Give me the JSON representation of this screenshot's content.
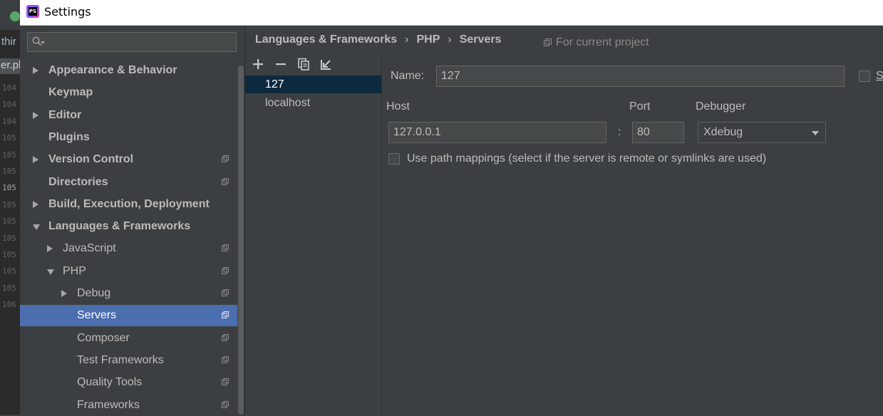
{
  "background_ide": {
    "text_1": "thir",
    "text_2": "er.pl",
    "line_numbers": [
      "104",
      "104",
      "104",
      "105",
      "105",
      "105",
      "105",
      "105",
      "105",
      "105",
      "105",
      "105",
      "105",
      "106"
    ]
  },
  "window": {
    "title": "Settings",
    "app_icon_text": "PS"
  },
  "sidebar": {
    "search": {
      "value": "",
      "placeholder": ""
    },
    "items": [
      {
        "label": "Appearance & Behavior",
        "bold": true,
        "expand": "collapsed",
        "level": 0,
        "project_scoped": false,
        "selected": false
      },
      {
        "label": "Keymap",
        "bold": true,
        "expand": "none",
        "level": 0,
        "project_scoped": false,
        "selected": false
      },
      {
        "label": "Editor",
        "bold": true,
        "expand": "collapsed",
        "level": 0,
        "project_scoped": false,
        "selected": false
      },
      {
        "label": "Plugins",
        "bold": true,
        "expand": "none",
        "level": 0,
        "project_scoped": false,
        "selected": false
      },
      {
        "label": "Version Control",
        "bold": true,
        "expand": "collapsed",
        "level": 0,
        "project_scoped": true,
        "selected": false
      },
      {
        "label": "Directories",
        "bold": true,
        "expand": "none",
        "level": 0,
        "project_scoped": true,
        "selected": false
      },
      {
        "label": "Build, Execution, Deployment",
        "bold": true,
        "expand": "collapsed",
        "level": 0,
        "project_scoped": false,
        "selected": false
      },
      {
        "label": "Languages & Frameworks",
        "bold": true,
        "expand": "expanded",
        "level": 0,
        "project_scoped": false,
        "selected": false
      },
      {
        "label": "JavaScript",
        "bold": false,
        "expand": "collapsed",
        "level": 1,
        "project_scoped": true,
        "selected": false
      },
      {
        "label": "PHP",
        "bold": false,
        "expand": "expanded",
        "level": 1,
        "project_scoped": true,
        "selected": false
      },
      {
        "label": "Debug",
        "bold": false,
        "expand": "collapsed",
        "level": 2,
        "project_scoped": true,
        "selected": false
      },
      {
        "label": "Servers",
        "bold": false,
        "expand": "none",
        "level": 2,
        "project_scoped": true,
        "selected": true
      },
      {
        "label": "Composer",
        "bold": false,
        "expand": "none",
        "level": 2,
        "project_scoped": true,
        "selected": false
      },
      {
        "label": "Test Frameworks",
        "bold": false,
        "expand": "none",
        "level": 2,
        "project_scoped": true,
        "selected": false
      },
      {
        "label": "Quality Tools",
        "bold": false,
        "expand": "none",
        "level": 2,
        "project_scoped": true,
        "selected": false
      },
      {
        "label": "Frameworks",
        "bold": false,
        "expand": "none",
        "level": 2,
        "project_scoped": true,
        "selected": false
      }
    ]
  },
  "breadcrumb": {
    "items": [
      "Languages & Frameworks",
      "PHP",
      "Servers"
    ],
    "separator": "›",
    "scope_label": "For current project"
  },
  "server_list": {
    "toolbar": {
      "add_icon": "plus-icon",
      "remove_icon": "minus-icon",
      "copy_icon": "copy-icon",
      "import_icon": "import-icon"
    },
    "items": [
      {
        "label": "127",
        "selected": true
      },
      {
        "label": "localhost",
        "selected": false
      }
    ]
  },
  "server_form": {
    "name_label": "Name:",
    "name_value": "127",
    "shared_label": "S",
    "host_label": "Host",
    "host_value": "127.0.0.1",
    "colon": ":",
    "port_label": "Port",
    "port_value": "80",
    "debugger_label": "Debugger",
    "debugger_value": "Xdebug",
    "path_mappings_label": "Use path mappings (select if the server is remote or symlinks are used)",
    "path_mappings_checked": false
  },
  "colors": {
    "background": "#3c3f41",
    "selection": "#4b6eaf",
    "list_selection": "#0d293e",
    "text": "#bbbbbb"
  }
}
